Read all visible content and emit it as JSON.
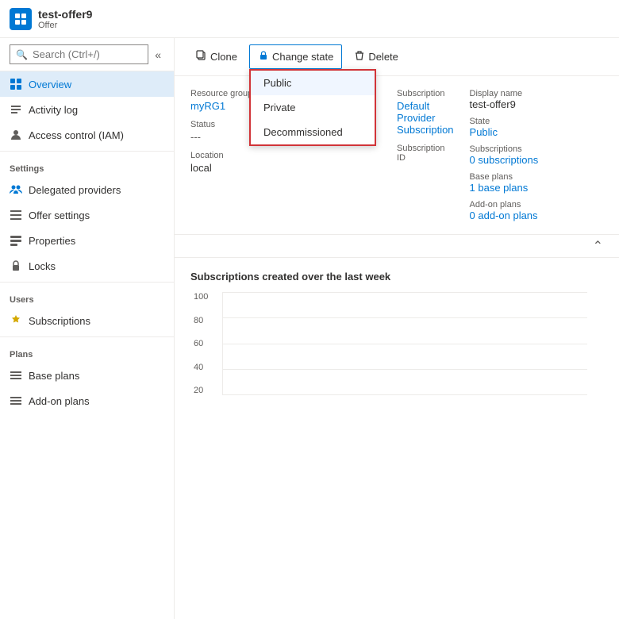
{
  "header": {
    "icon_label": "offer-icon",
    "title": "test-offer9",
    "subtitle": "Offer"
  },
  "sidebar": {
    "search_placeholder": "Search (Ctrl+/)",
    "collapse_icon": "«",
    "nav_items": [
      {
        "id": "overview",
        "label": "Overview",
        "icon": "grid",
        "active": true
      },
      {
        "id": "activity-log",
        "label": "Activity log",
        "icon": "list"
      },
      {
        "id": "access-control",
        "label": "Access control (IAM)",
        "icon": "person"
      }
    ],
    "sections": [
      {
        "header": "Settings",
        "items": [
          {
            "id": "delegated-providers",
            "label": "Delegated providers",
            "icon": "person-group"
          },
          {
            "id": "offer-settings",
            "label": "Offer settings",
            "icon": "bars"
          },
          {
            "id": "properties",
            "label": "Properties",
            "icon": "props"
          },
          {
            "id": "locks",
            "label": "Locks",
            "icon": "lock"
          }
        ]
      },
      {
        "header": "Users",
        "items": [
          {
            "id": "subscriptions",
            "label": "Subscriptions",
            "icon": "key"
          }
        ]
      },
      {
        "header": "Plans",
        "items": [
          {
            "id": "base-plans",
            "label": "Base plans",
            "icon": "list2"
          },
          {
            "id": "add-on-plans",
            "label": "Add-on plans",
            "icon": "list2"
          }
        ]
      }
    ]
  },
  "toolbar": {
    "clone_label": "Clone",
    "change_state_label": "Change state",
    "delete_label": "Delete",
    "clone_icon": "copy",
    "change_state_icon": "lock",
    "delete_icon": "trash"
  },
  "dropdown": {
    "items": [
      "Public",
      "Private",
      "Decommissioned"
    ],
    "selected": "Public"
  },
  "detail": {
    "resource_group_label": "Resource group",
    "resource_group_value": "myRG1",
    "status_label": "Status",
    "status_value": "---",
    "location_label": "Location",
    "location_value": "local",
    "subscription_label": "Subscription",
    "subscription_value": "Default Provider Subscription",
    "subscription_id_label": "Subscription ID",
    "subscription_id_value": ""
  },
  "right_details": {
    "display_name_label": "Display name",
    "display_name_value": "test-offer9",
    "state_label": "State",
    "state_value": "Public",
    "subscriptions_label": "Subscriptions",
    "subscriptions_value": "0 subscriptions",
    "base_plans_label": "Base plans",
    "base_plans_value": "1 base plans",
    "addon_plans_label": "Add-on plans",
    "addon_plans_value": "0 add-on plans"
  },
  "chart": {
    "title": "Subscriptions created over the last week",
    "y_labels": [
      "100",
      "80",
      "60",
      "40",
      "20"
    ]
  }
}
